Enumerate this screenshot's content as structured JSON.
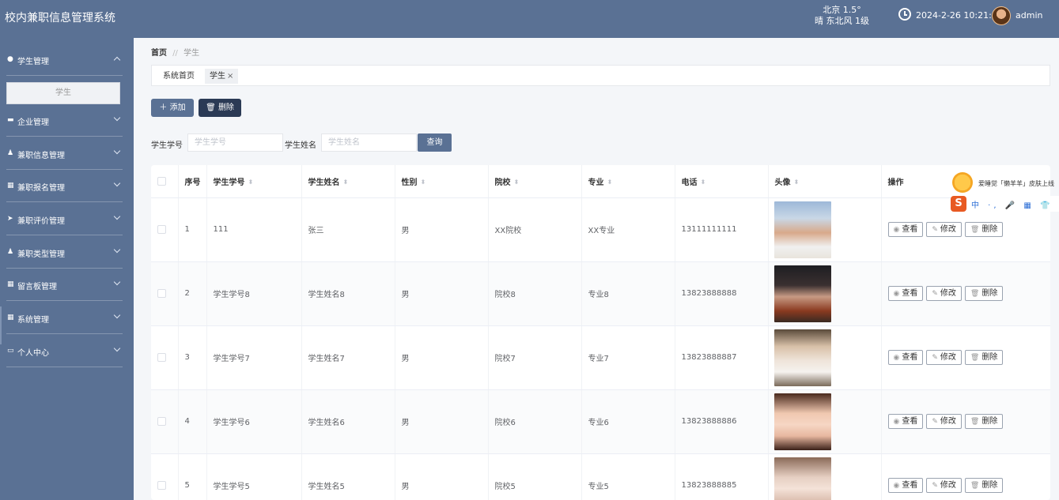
{
  "app": {
    "title": "校内兼职信息管理系统"
  },
  "header": {
    "weather_line1": "北京  1.5°",
    "weather_line2": "晴  东北风  1级",
    "datetime": "2024-2-26 10:21:8",
    "username": "admin"
  },
  "sidebar": {
    "items": [
      {
        "label": "学生管理",
        "icon": "bulb-icon",
        "expanded": true
      },
      {
        "label": "企业管理",
        "icon": "chat-icon"
      },
      {
        "label": "兼职信息管理",
        "icon": "user-icon"
      },
      {
        "label": "兼职报名管理",
        "icon": "grid-icon"
      },
      {
        "label": "兼职评价管理",
        "icon": "send-icon"
      },
      {
        "label": "兼职类型管理",
        "icon": "user-icon"
      },
      {
        "label": "留言板管理",
        "icon": "grid-icon"
      },
      {
        "label": "系统管理",
        "icon": "grid-icon"
      },
      {
        "label": "个人中心",
        "icon": "calendar-icon"
      }
    ],
    "submenu": {
      "label": "学生"
    }
  },
  "breadcrumb": {
    "home": "首页",
    "sep": "//",
    "current": "学生"
  },
  "tabs": {
    "home": "系统首页",
    "active": "学生",
    "close": "×"
  },
  "toolbar": {
    "add_label": "添加",
    "delete_label": "删除"
  },
  "search": {
    "student_id_label": "学生学号",
    "student_id_placeholder": "学生学号",
    "student_name_label": "学生姓名",
    "student_name_placeholder": "学生姓名",
    "button_label": "查询"
  },
  "table": {
    "headers": {
      "index": "序号",
      "student_id": "学生学号",
      "name": "学生姓名",
      "gender": "性别",
      "school": "院校",
      "major": "专业",
      "phone": "电话",
      "avatar": "头像",
      "actions": "操作"
    },
    "actions": {
      "view": "查看",
      "edit": "修改",
      "delete": "删除"
    },
    "rows": [
      {
        "index": "1",
        "student_id": "111",
        "name": "张三",
        "gender": "男",
        "school": "XX院校",
        "major": "XX专业",
        "phone": "13111111111"
      },
      {
        "index": "2",
        "student_id": "学生学号8",
        "name": "学生姓名8",
        "gender": "男",
        "school": "院校8",
        "major": "专业8",
        "phone": "13823888888"
      },
      {
        "index": "3",
        "student_id": "学生学号7",
        "name": "学生姓名7",
        "gender": "男",
        "school": "院校7",
        "major": "专业7",
        "phone": "13823888887"
      },
      {
        "index": "4",
        "student_id": "学生学号6",
        "name": "学生姓名6",
        "gender": "男",
        "school": "院校6",
        "major": "专业6",
        "phone": "13823888886"
      },
      {
        "index": "5",
        "student_id": "学生学号5",
        "name": "学生姓名5",
        "gender": "男",
        "school": "院校5",
        "major": "专业5",
        "phone": "13823888885"
      }
    ]
  },
  "ime": {
    "notice": "爱睡觉「懒羊羊」皮肤上线",
    "logo": "S",
    "tools": "中 ·, 🎤 ▦ 👕 ⊕ ▦"
  },
  "colors": {
    "primary": "#5a7194",
    "dark_button": "#2b3a55",
    "page_bg": "#f4f6f9"
  }
}
